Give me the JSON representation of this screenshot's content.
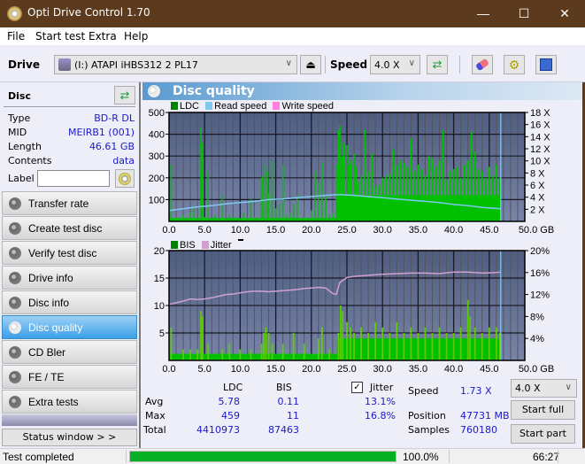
{
  "window": {
    "title": "Opti Drive Control 1.70",
    "minimize": "—",
    "maximize": "☐",
    "close": "✕"
  },
  "menu": [
    "File",
    "Start test",
    "Extra",
    "Help"
  ],
  "toolbar": {
    "drive_label": "Drive",
    "drive_value": "(I:)  ATAPI iHBS312   2 PL17",
    "speed_label": "Speed",
    "speed_value": "4.0 X"
  },
  "disc": {
    "header": "Disc",
    "props": [
      {
        "label": "Type",
        "value": "BD-R DL"
      },
      {
        "label": "MID",
        "value": "MEIRB1 (001)"
      },
      {
        "label": "Length",
        "value": "46.61 GB"
      },
      {
        "label": "Contents",
        "value": "data"
      }
    ],
    "label_field_label": "Label",
    "label_value": ""
  },
  "nav": [
    {
      "label": "Transfer rate",
      "active": false
    },
    {
      "label": "Create test disc",
      "active": false
    },
    {
      "label": "Verify test disc",
      "active": false
    },
    {
      "label": "Drive info",
      "active": false
    },
    {
      "label": "Disc info",
      "active": false
    },
    {
      "label": "Disc quality",
      "active": true
    },
    {
      "label": "CD Bler",
      "active": false
    },
    {
      "label": "FE / TE",
      "active": false
    },
    {
      "label": "Extra tests",
      "active": false
    }
  ],
  "status_window_button": "Status window > >",
  "panel_title": "Disc quality",
  "colors": {
    "ldc": "#00c000",
    "bis": "#00c000",
    "read_speed": "#7fc8f0",
    "write_speed": "#ff80e0",
    "jitter": "#d0a0d0",
    "plot_bg_top": "#4e5d80",
    "plot_bg_bottom": "#7884a8",
    "progress": "#06b025"
  },
  "chart_data": [
    {
      "type": "bar",
      "title": "LDC / Read speed",
      "legend": [
        "LDC",
        "Read speed",
        "Write speed"
      ],
      "legend_placement": "top-left",
      "xlabel": "GB",
      "x_ticks": [
        "0.0",
        "5.0",
        "10.0",
        "15.0",
        "20.0",
        "25.0",
        "30.0",
        "35.0",
        "40.0",
        "45.0",
        "50.0 GB"
      ],
      "xlim": [
        0,
        50
      ],
      "y_ticks_left": [
        "100",
        "200",
        "300",
        "400",
        "500"
      ],
      "ylim_left": [
        0,
        500
      ],
      "y_ticks_right": [
        "2 X",
        "4 X",
        "6 X",
        "8 X",
        "10 X",
        "12 X",
        "14 X",
        "16 X",
        "18 X"
      ],
      "ylim_right": [
        0,
        18
      ],
      "end_marker_gb": 46.61,
      "series": [
        {
          "name": "LDC",
          "kind": "bar",
          "x": [
            0.3,
            1.0,
            2.0,
            3.0,
            3.5,
            4.5,
            4.7,
            5.0,
            5.5,
            6.5,
            7.5,
            8.5,
            9.5,
            10.5,
            11.5,
            12.0,
            13.0,
            13.2,
            13.5,
            13.8,
            14.0,
            14.5,
            15.0,
            15.5,
            16.0,
            16.5,
            17.0,
            17.5,
            18.0,
            19.0,
            20.0,
            20.5,
            21.0,
            21.5,
            22.0,
            22.5,
            23.0,
            23.5,
            23.8,
            24.0,
            24.3,
            24.6,
            25.0,
            25.3,
            25.6,
            26.0,
            26.3,
            26.6,
            27.0,
            27.5,
            28.0,
            28.5,
            29.0,
            29.5,
            30.0,
            30.5,
            31.0,
            31.5,
            32.0,
            32.5,
            33.0,
            33.5,
            34.0,
            34.5,
            35.0,
            35.5,
            36.0,
            36.5,
            37.0,
            37.5,
            38.0,
            38.5,
            39.0,
            39.5,
            40.0,
            40.5,
            41.0,
            41.5,
            42.0,
            42.5,
            43.0,
            43.5,
            44.0,
            44.5,
            45.0,
            45.5,
            46.0,
            46.5
          ],
          "values": [
            260,
            20,
            30,
            40,
            60,
            430,
            360,
            20,
            230,
            30,
            120,
            30,
            20,
            40,
            100,
            20,
            200,
            210,
            260,
            230,
            130,
            280,
            60,
            80,
            260,
            30,
            40,
            80,
            120,
            20,
            50,
            230,
            180,
            270,
            120,
            30,
            40,
            260,
            420,
            440,
            300,
            360,
            350,
            260,
            280,
            310,
            250,
            180,
            210,
            420,
            230,
            310,
            160,
            170,
            200,
            210,
            220,
            330,
            260,
            280,
            270,
            250,
            380,
            230,
            260,
            240,
            210,
            300,
            290,
            250,
            280,
            420,
            190,
            230,
            240,
            250,
            200,
            260,
            280,
            410,
            320,
            240,
            230,
            200,
            250,
            210,
            260,
            200
          ]
        },
        {
          "name": "Read speed",
          "kind": "line",
          "x": [
            0,
            2,
            4,
            6,
            8,
            10,
            12,
            14,
            16,
            18,
            20,
            22,
            23.5,
            24,
            26,
            28,
            30,
            32,
            34,
            36,
            38,
            40,
            42,
            44,
            46.6
          ],
          "values": [
            1.8,
            2.1,
            2.4,
            2.6,
            2.9,
            3.1,
            3.3,
            3.6,
            3.7,
            3.9,
            4.1,
            4.3,
            4.4,
            4.4,
            4.3,
            4.1,
            3.9,
            3.7,
            3.5,
            3.3,
            3.1,
            2.8,
            2.6,
            2.3,
            2.1
          ]
        },
        {
          "name": "Write speed",
          "kind": "line",
          "x": [],
          "values": []
        }
      ]
    },
    {
      "type": "bar",
      "title": "BIS / Jitter",
      "legend": [
        "BIS",
        "Jitter"
      ],
      "legend_placement": "top-left",
      "xlabel": "GB",
      "x_ticks": [
        "0.0",
        "5.0",
        "10.0",
        "15.0",
        "20.0",
        "25.0",
        "30.0",
        "35.0",
        "40.0",
        "45.0",
        "50.0 GB"
      ],
      "xlim": [
        0,
        50
      ],
      "y_ticks_left": [
        "5",
        "10",
        "15",
        "20"
      ],
      "ylim_left": [
        0,
        20
      ],
      "y_ticks_right": [
        "4%",
        "8%",
        "12%",
        "16%",
        "20%"
      ],
      "ylim_right": [
        0,
        20
      ],
      "end_marker_gb": 46.61,
      "series": [
        {
          "name": "BIS",
          "kind": "bar",
          "x": [
            0.3,
            2.0,
            3.0,
            4.0,
            4.5,
            4.7,
            5.5,
            7.5,
            8.5,
            10.0,
            11.5,
            13.0,
            13.3,
            13.6,
            14.0,
            14.5,
            16.0,
            17.5,
            19.0,
            21.0,
            21.5,
            22.5,
            23.8,
            24.1,
            24.4,
            25.0,
            25.5,
            26.0,
            27.0,
            28.0,
            29.0,
            30.0,
            31.0,
            32.0,
            33.0,
            34.0,
            35.0,
            36.0,
            37.0,
            38.0,
            39.0,
            40.0,
            41.0,
            42.0,
            42.3,
            43.0,
            44.0,
            45.0,
            46.0,
            46.5
          ],
          "values": [
            6,
            2,
            2,
            2,
            9,
            8,
            3,
            2,
            3,
            2,
            2,
            3,
            5,
            6,
            5,
            3,
            3,
            5,
            3,
            4,
            6,
            2,
            5,
            10,
            9,
            7,
            6,
            5,
            6,
            5,
            7,
            6,
            5,
            7,
            5,
            6,
            5,
            6,
            5,
            6,
            5,
            5,
            6,
            11,
            8,
            6,
            5,
            6,
            6,
            5
          ]
        },
        {
          "name": "Jitter",
          "kind": "line",
          "unit": "%",
          "x": [
            0,
            1,
            2,
            3,
            4,
            5,
            6,
            7,
            8,
            9,
            10,
            11,
            12,
            13,
            14,
            15,
            16,
            17,
            18,
            19,
            20,
            21,
            22,
            22.5,
            23,
            23.5,
            24,
            25,
            26,
            28,
            30,
            32,
            34,
            36,
            38,
            40,
            42,
            44,
            46,
            46.6
          ],
          "values": [
            10.2,
            10.5,
            10.8,
            11.2,
            11.1,
            11.2,
            11.4,
            11.7,
            12.0,
            12.1,
            12.3,
            12.5,
            12.6,
            12.6,
            12.5,
            12.6,
            12.7,
            12.8,
            12.9,
            13.1,
            13.2,
            13.3,
            13.2,
            12.7,
            12.2,
            12.0,
            14.2,
            15.1,
            15.3,
            15.5,
            15.7,
            15.8,
            15.9,
            15.9,
            15.8,
            16.1,
            16.1,
            15.9,
            16.0,
            16.1
          ]
        }
      ]
    }
  ],
  "stats": {
    "col_ldc": "LDC",
    "col_bis": "BIS",
    "row_avg": "Avg",
    "row_max": "Max",
    "row_total": "Total",
    "ldc_avg": "5.78",
    "ldc_max": "459",
    "ldc_total": "4410973",
    "bis_avg": "0.11",
    "bis_max": "11",
    "bis_total": "87463",
    "jitter_label": "Jitter",
    "jitter_checked": true,
    "jitter_avg": "13.1%",
    "jitter_max": "16.8%",
    "speed_label": "Speed",
    "speed_value": "1.73 X",
    "position_label": "Position",
    "position_value": "47731 MB",
    "samples_label": "Samples",
    "samples_value": "760180",
    "speed_select": "4.0 X",
    "start_full": "Start full",
    "start_part": "Start part"
  },
  "statusbar": {
    "text": "Test completed",
    "progress_percent": 100.0,
    "progress_label": "100.0%",
    "elapsed": "66:27"
  }
}
